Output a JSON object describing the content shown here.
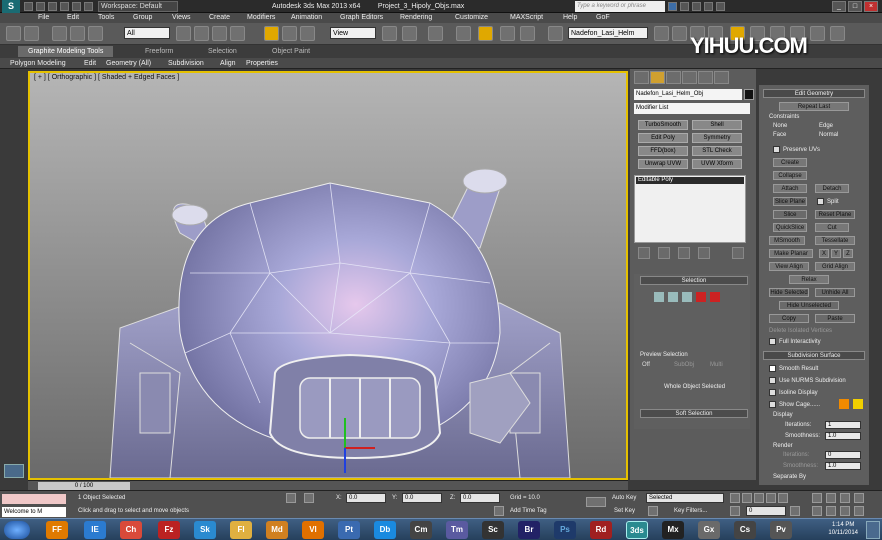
{
  "titlebar": {
    "workspace": "Workspace: Default",
    "app_title": "Autodesk 3ds Max  2013 x64",
    "file_title": "Project_3_Hipoly_Objs.max",
    "search_placeholder": "Type a keyword or phrase",
    "win_min": "_",
    "win_max": "□",
    "win_close": "×"
  },
  "menu": {
    "file": "File",
    "edit": "Edit",
    "tools": "Tools",
    "group": "Group",
    "views": "Views",
    "create": "Create",
    "modifiers": "Modifiers",
    "animation": "Animation",
    "graph_editors": "Graph Editors",
    "rendering": "Rendering",
    "customize": "Customize",
    "maxscript": "MAXScript",
    "help": "Help",
    "gof": "GoF"
  },
  "toolbar": {
    "filter_select": "All",
    "refcoord_select": "View",
    "named_selection": "Nadefon_Lasi_Helm"
  },
  "ribbon": {
    "tab_graphite": "Graphite Modeling Tools",
    "tab_freeform": "Freeform",
    "tab_selection": "Selection",
    "tab_objectpaint": "Object Paint",
    "sub_polymodel": "Polygon Modeling",
    "sub_edit": "Edit",
    "sub_geometry": "Geometry (All)",
    "sub_subdivision": "Subdivision",
    "sub_align": "Align",
    "sub_properties": "Properties"
  },
  "viewport": {
    "label": "[ + ] [ Orthographic ] [ Shaded + Edged Faces ]"
  },
  "cmdpanel": {
    "object_name": "Nadefon_Lasi_Helm_Obj",
    "modifier_list": "Modifier List",
    "buttons": [
      "TurboSmooth",
      "Shell",
      "Edit Poly",
      "Symmetry",
      "FFD(box)",
      "STL Check",
      "Unwrap UVW",
      "UVW Xform"
    ],
    "stack_item": "Editable Poly",
    "selection_header": "Selection",
    "preview_selection": "Preview Selection",
    "off": "Off",
    "subobj": "SubObj",
    "multi": "Multi",
    "whole_object_selected": "Whole Object Selected",
    "soft_selection": "Soft Selection"
  },
  "rpanel": {
    "edit_geometry": "Edit Geometry",
    "repeat_last": "Repeat Last",
    "constraints": "Constraints",
    "none": "None",
    "edge": "Edge",
    "face": "Face",
    "normal": "Normal",
    "preserve_uvs": "Preserve UVs",
    "create": "Create",
    "collapse": "Collapse",
    "attach": "Attach",
    "detach": "Detach",
    "slice_plane": "Slice Plane",
    "split": "Split",
    "slice": "Slice",
    "reset_plane": "Reset Plane",
    "quickslice": "QuickSlice",
    "cut": "Cut",
    "msmooth": "MSmooth",
    "tessellate": "Tessellate",
    "make_planar": "Make Planar",
    "x": "X",
    "y": "Y",
    "z": "Z",
    "view_align": "View Align",
    "grid_align": "Grid Align",
    "relax": "Relax",
    "hide_selected": "Hide Selected",
    "unhide_all": "Unhide All",
    "hide_unselected": "Hide Unselected",
    "copy": "Copy",
    "paste": "Paste",
    "delete_isolated": "Delete Isolated Vertices",
    "full_interactivity": "Full Interactivity",
    "subdivision_surface": "Subdivision Surface",
    "smooth_result": "Smooth Result",
    "use_nurms": "Use NURMS Subdivision",
    "isoline_display": "Isoline Display",
    "show_cage": "Show Cage......",
    "display": "Display",
    "iterations": "Iterations:",
    "iterations_val": "1",
    "smoothness": "Smoothness:",
    "smoothness_val": "1.0",
    "render": "Render",
    "render_iterations": "Iterations:",
    "render_iterations_val": "0",
    "render_smoothness": "Smoothness:",
    "render_smoothness_val": "1.0",
    "separate_by": "Separate By",
    "colors": {
      "cage1": "#f08a00",
      "cage2": "#f0d000"
    }
  },
  "watermark": "YIHUU.COM",
  "timeslider": {
    "frame": "0 / 100"
  },
  "status": {
    "welcome": "Welcome to M",
    "selected": "1 Object Selected",
    "prompt": "Click and drag to select and move objects",
    "x_label": "X:",
    "x_val": "0.0",
    "y_label": "Y:",
    "y_val": "0.0",
    "z_label": "Z:",
    "z_val": "0.0",
    "grid": "Grid = 10.0",
    "add_time_tag": "Add Time Tag",
    "auto_key": "Auto Key",
    "set_key": "Set Key",
    "key_mode": "Selected",
    "key_filters": "Key Filters...",
    "frame_field": "0"
  },
  "taskbar": {
    "time": "1:14 PM",
    "date": "10/11/2014",
    "apps": [
      "IE",
      "FF",
      "Ch",
      "Fz",
      "Sk",
      "Fl",
      "Md",
      "Vl",
      "Pt",
      "Db",
      "Cm",
      "Tm",
      "Sc",
      "Br",
      "Ps",
      "Rd",
      "3ds",
      "Mx",
      "Gx",
      "Cs",
      "Pv"
    ]
  }
}
